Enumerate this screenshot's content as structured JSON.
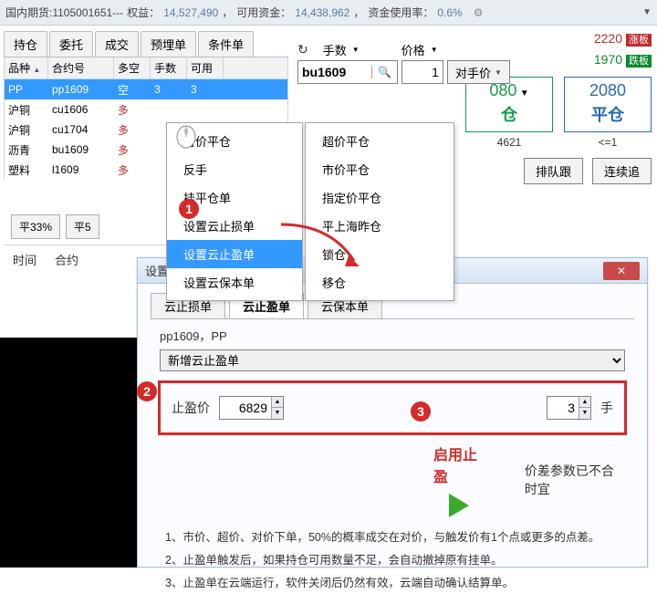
{
  "title": {
    "prefix": "国内期货:1105001651---",
    "equity_lbl": "权益：",
    "equity_val": "14,527,490",
    "avail_lbl": "可用资金：",
    "avail_val": "14,438,962",
    "usage_lbl": "资金使用率：",
    "usage_val": "0.6%"
  },
  "tabs1": [
    "持仓",
    "委托",
    "成交",
    "预埋单",
    "条件单"
  ],
  "table": {
    "cols": [
      "品种",
      "合约号",
      "多空",
      "手数",
      "可用"
    ],
    "rows": [
      {
        "v": "PP",
        "c": "pp1609",
        "d": "空",
        "q": "3",
        "a": "3",
        "sel": true
      },
      {
        "v": "沪铜",
        "c": "cu1606",
        "d": "多"
      },
      {
        "v": "沪铜",
        "c": "cu1704",
        "d": "多"
      },
      {
        "v": "沥青",
        "c": "bu1609",
        "d": "多"
      },
      {
        "v": "塑料",
        "c": "l1609",
        "d": "多"
      }
    ]
  },
  "left_btns": [
    "平33%",
    "平5"
  ],
  "timeline": [
    "时间",
    "合约"
  ],
  "menu1": [
    "对价平仓",
    "反手",
    "挂平仓单",
    "设置云止损单",
    "设置云止盈单",
    "设置云保本单"
  ],
  "menu1_hl": 4,
  "menu2": [
    "超价平仓",
    "市价平仓",
    "指定价平仓",
    "平上海昨仓",
    "锁仓",
    "移仓"
  ],
  "right": {
    "qty_lbl": "手数",
    "price_lbl": "价格",
    "up_price": "2220",
    "up_lbl": "涨板",
    "dn_price": "1970",
    "dn_lbl": "跌板",
    "search_val": "bu1609",
    "qty_val": "1",
    "cp_lbl": "对手价",
    "big1_price": "080",
    "big1_lbl": "仓",
    "big2_price": "2080",
    "big2_lbl": "平仓",
    "under1": "4621",
    "under2": "<=1",
    "btns": [
      "排队跟",
      "连续追"
    ]
  },
  "child": {
    "title": "设置云止盈单",
    "tabs": [
      "云止损单",
      "云止盈单",
      "云保本单"
    ],
    "active_tab": 1,
    "contract": "pp1609，PP",
    "select": "新增云止盈单",
    "price_lbl": "止盈价",
    "price_val": "6829",
    "qty_val": "3",
    "qty_unit": "手",
    "enable_lbl": "启用止盈",
    "note": "价差参数已不合时宜",
    "lines": [
      "1、市价、超价、对价下单，50%的概率成交在对价，与触发价有1个点或更多的点差。",
      "2、止盈单触发后，如果持仓可用数量不足，会自动撤掉原有挂单。",
      "3、止盈单在云端运行，软件关闭后仍然有效，云端自动确认结算单。"
    ]
  },
  "badges": {
    "b1": "1",
    "b2": "2",
    "b3": "3"
  }
}
